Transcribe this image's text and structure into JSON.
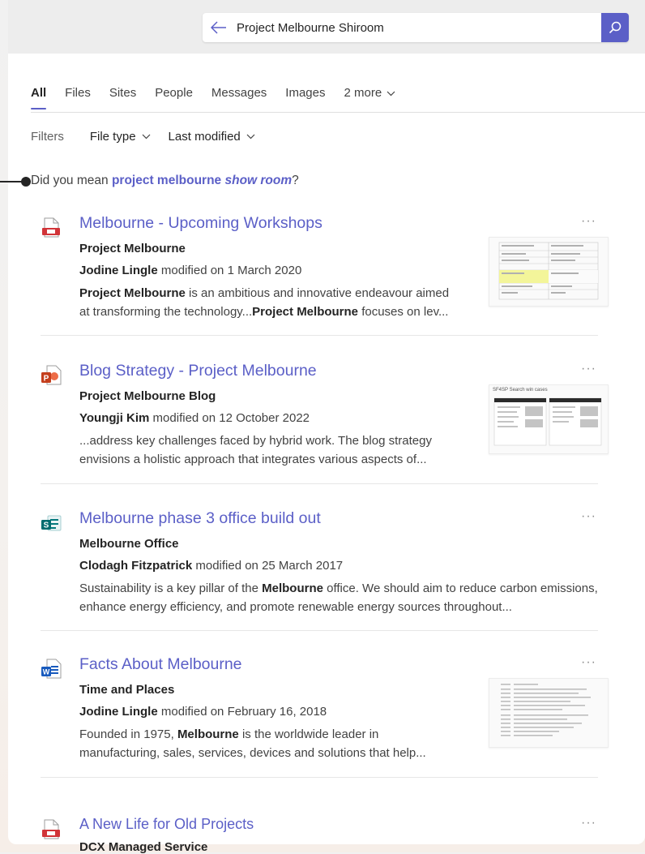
{
  "search": {
    "query": "Project Melbourne Shiroom"
  },
  "tabs": [
    "All",
    "Files",
    "Sites",
    "People",
    "Messages",
    "Images",
    "2 more"
  ],
  "filters": {
    "label": "Filters",
    "file_type": "File type",
    "last_modified": "Last modified"
  },
  "suggestion": {
    "prefix": "Did you mean ",
    "term_a": "project melbourne ",
    "term_b": "show room",
    "suffix": "?"
  },
  "results": [
    {
      "icon": "pdf-file-icon",
      "title": "Melbourne - Upcoming Workshops",
      "site": "Project Melbourne",
      "author": "Jodine Lingle",
      "modified": " modified on 1 March 2020",
      "snippet": [
        {
          "b": "Project Melbourne"
        },
        {
          "t": " is an ambitious and innovative endeavour aimed at transforming the technology..."
        },
        {
          "b": "Project Melbourne"
        },
        {
          "t": " focuses on lev..."
        }
      ]
    },
    {
      "icon": "powerpoint-file-icon",
      "title": "Blog Strategy - Project Melbourne",
      "site": "Project Melbourne Blog",
      "author": "Youngji Kim",
      "modified": " modified on 12 October 2022",
      "snippet": [
        {
          "t": "...address key challenges faced by hybrid work. The blog strategy envisions a holistic approach that integrates various aspects of..."
        }
      ],
      "thumb_title": "SF4SP Search win cases"
    },
    {
      "icon": "sharepoint-icon",
      "title": "Melbourne phase 3 office build out",
      "site": "Melbourne Office",
      "author": "Clodagh Fitzpatrick",
      "modified": " modified on 25 March 2017",
      "snippet": [
        {
          "t": "Sustainability is a key pillar of the "
        },
        {
          "b": "Melbourne"
        },
        {
          "t": " office. We should aim to reduce carbon emissions, enhance energy efficiency, and promote renewable energy sources throughout..."
        }
      ]
    },
    {
      "icon": "word-file-icon",
      "title": "Facts About Melbourne",
      "site": "Time and Places",
      "author": "Jodine Lingle",
      "modified": " modified on February 16, 2018",
      "snippet": [
        {
          "t": "Founded in 1975, "
        },
        {
          "b": "Melbourne"
        },
        {
          "t": " is the worldwide leader in manufacturing, sales, services, devices and solutions that help..."
        }
      ]
    },
    {
      "icon": "pdf-file-icon",
      "title": "A New Life for Old Projects",
      "site": "DCX Managed Service"
    }
  ],
  "more_label": "···"
}
